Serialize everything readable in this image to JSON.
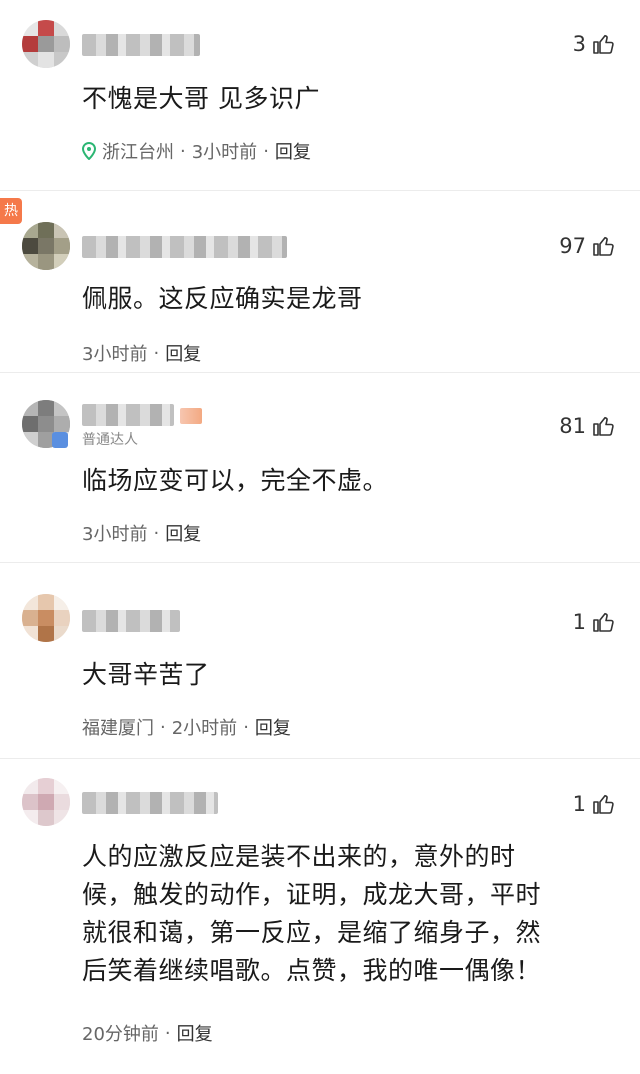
{
  "comments": [
    {
      "text": "不愧是大哥 见多识广",
      "likes": "3",
      "location": "浙江台州",
      "time": "3小时前",
      "reply": "回复"
    },
    {
      "hot_label": "热",
      "text": "佩服。这反应确实是龙哥",
      "likes": "97",
      "time": "3小时前",
      "reply": "回复"
    },
    {
      "badge": "普通达人",
      "text": "临场应变可以，完全不虚。",
      "likes": "81",
      "time": "3小时前",
      "reply": "回复"
    },
    {
      "text": "大哥辛苦了",
      "likes": "1",
      "location": "福建厦门",
      "time": "2小时前",
      "reply": "回复"
    },
    {
      "text_lines": [
        "人的应激反应是装不出来的，意外的时",
        "候，触发的动作，证明，成龙大哥，平时",
        "就很和蔼，第一反应，是缩了缩身子，然",
        "后笑着继续唱歌。点赞，我的唯一偶像！"
      ],
      "likes": "1",
      "time": "20分钟前",
      "reply": "回复"
    }
  ],
  "separator": "·",
  "colors": {
    "hot": "#f5794a",
    "location_icon": "#2bb673",
    "meta": "#666666"
  },
  "icons": {
    "like": "thumbs-up-icon",
    "location": "location-pin-icon"
  }
}
